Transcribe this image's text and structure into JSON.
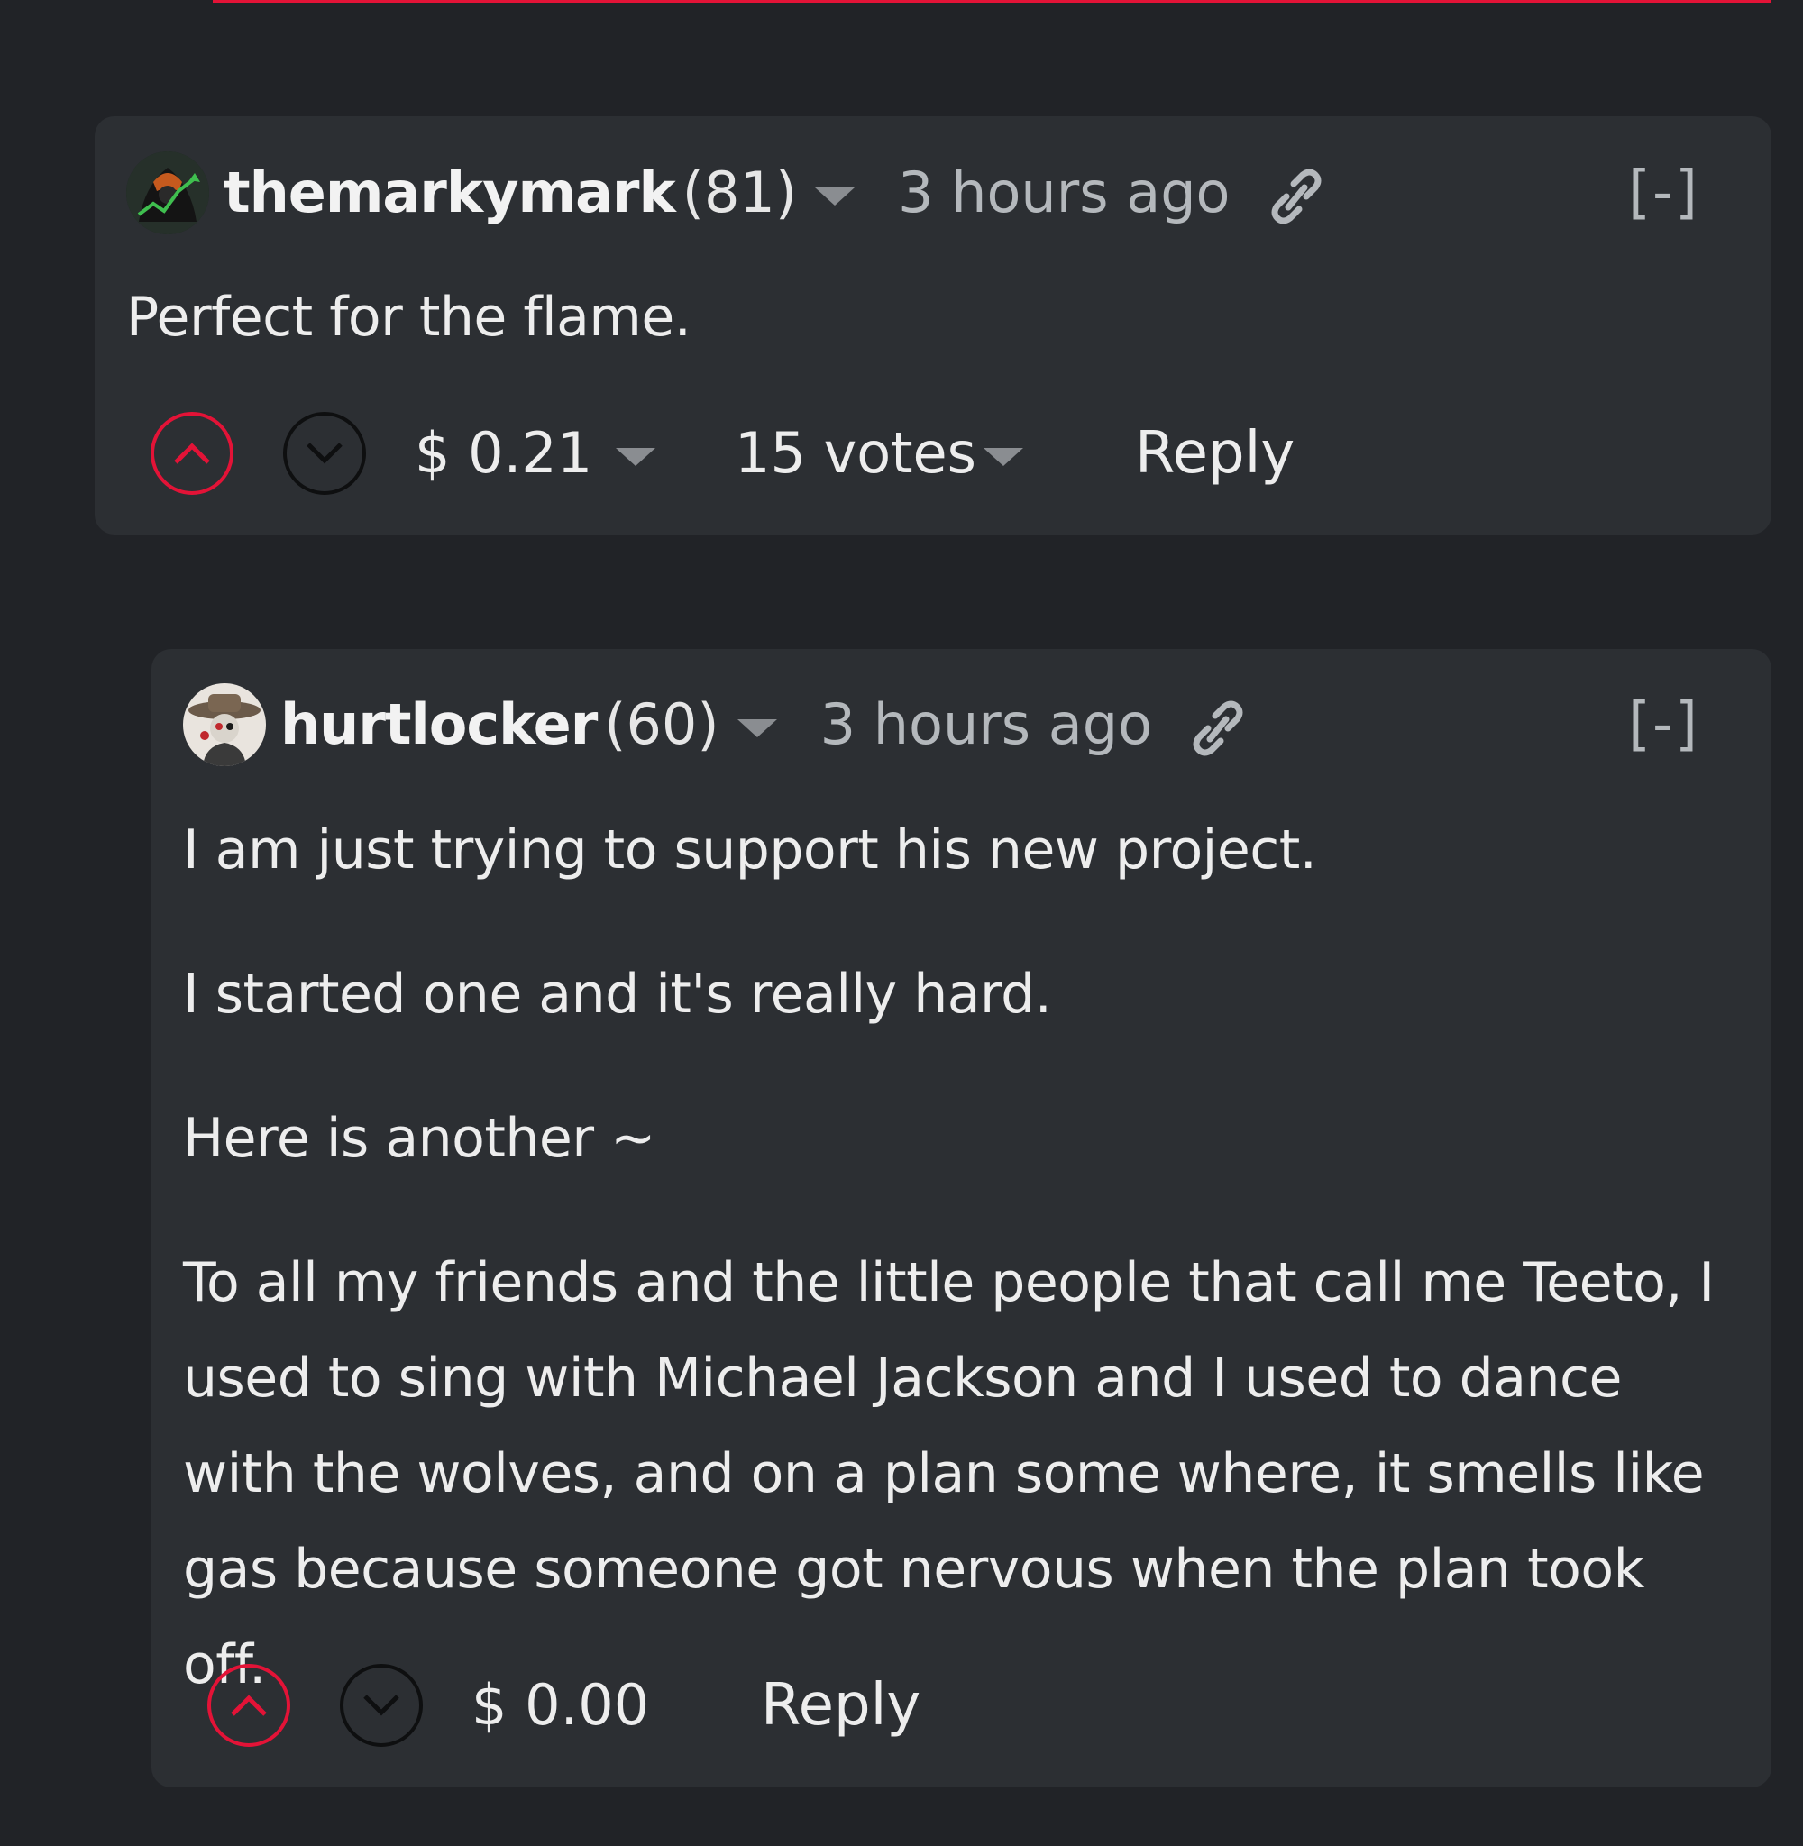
{
  "comments": [
    {
      "author": "themarkymark",
      "reputation": "(81)",
      "timestamp": "3 hours ago",
      "collapse_label": "[-]",
      "paragraphs": [
        "Perfect for the flame."
      ],
      "payout": "$ 0.21",
      "votes": "15 votes",
      "reply_label": "Reply",
      "avatar_icon": "avatar-themarkymark-icon"
    },
    {
      "author": "hurtlocker",
      "reputation": "(60)",
      "timestamp": "3 hours ago",
      "collapse_label": "[-]",
      "paragraphs": [
        "I am just trying to support his new project.",
        "I started one and it's really hard.",
        "Here is another ~"
      ],
      "long_paragraph_lines": [
        "To all my friends and the little people that call me Teeto, I",
        "used to sing with Michael Jackson and I used to dance",
        "with the wolves, and on a plan some where, it smells like",
        "gas because someone got nervous when the plan took off."
      ],
      "payout": "$ 0.00",
      "reply_label": "Reply",
      "avatar_icon": "avatar-hurtlocker-icon"
    }
  ],
  "colors": {
    "background": "#212327",
    "card": "#2c2f33",
    "accent_red": "#e31337",
    "muted_text": "#b4b8bc",
    "text": "#ededed"
  },
  "icons": {
    "link": "link-icon",
    "upvote": "chevron-up-icon",
    "downvote": "chevron-down-icon",
    "dropdown": "caret-down-icon"
  }
}
